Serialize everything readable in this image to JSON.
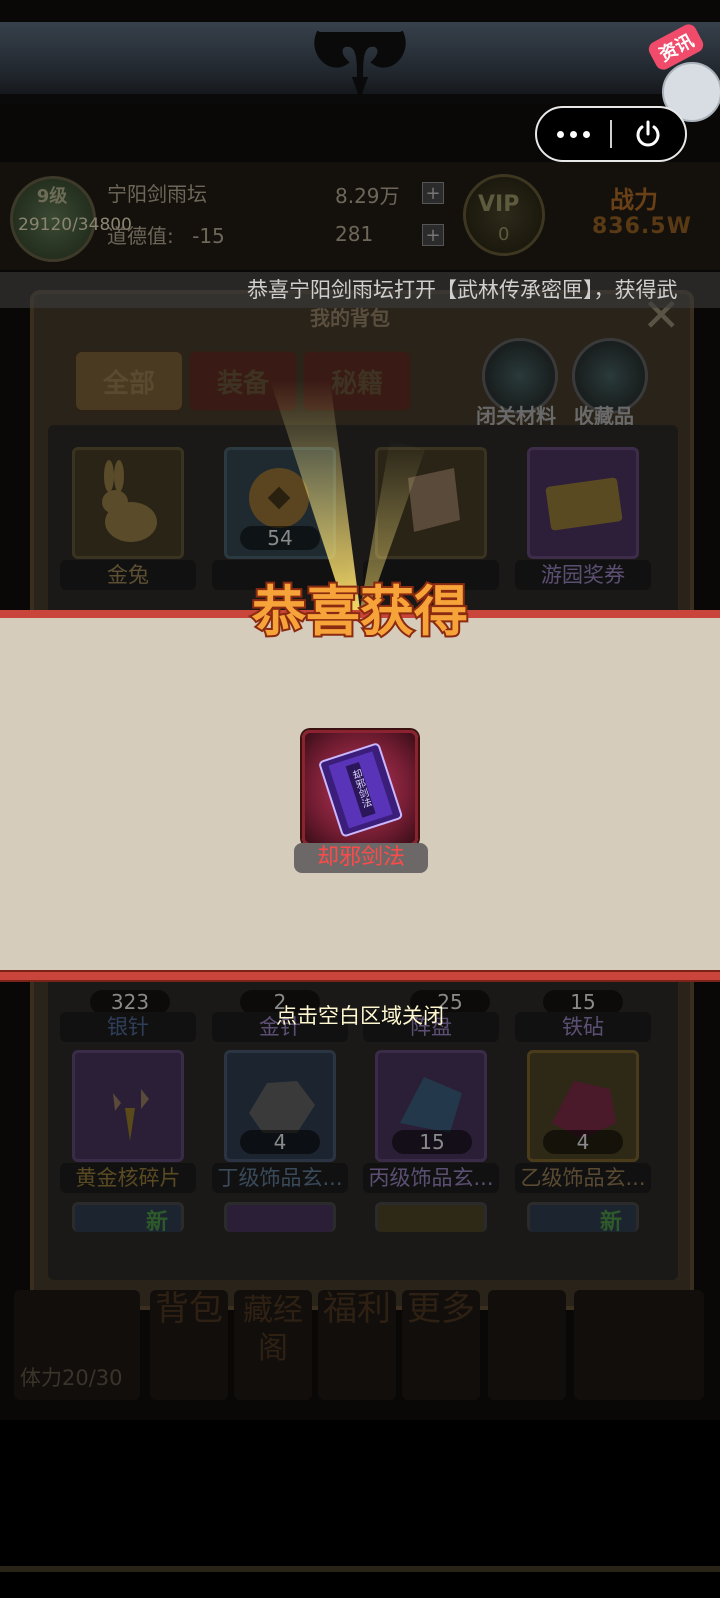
{
  "news_badge": {
    "label": "资讯"
  },
  "hud": {
    "level": "9级",
    "hp": "29120/34800",
    "player_name": "宁阳剑雨坛",
    "morality_label": "道德值:",
    "morality_value": "-15",
    "silver": "8.29万",
    "gold": "281",
    "vip_label": "VIP",
    "vip_level": "0",
    "power_label": "战力",
    "power_value": "836.5W"
  },
  "marquee": "恭喜宁阳剑雨坛打开【武林传承密匣】，获得武",
  "bag": {
    "title": "我的背包",
    "tabs": [
      "全部",
      "装备",
      "秘籍"
    ],
    "side_buttons": [
      "闭关材料",
      "收藏品"
    ],
    "items": [
      {
        "name": "金兔",
        "count": ""
      },
      {
        "name": "",
        "count": "54"
      },
      {
        "name": "",
        "count": ""
      },
      {
        "name": "游园奖券",
        "count": ""
      },
      {
        "name": "银针",
        "count": "323"
      },
      {
        "name": "金针",
        "count": "2"
      },
      {
        "name": "阵盘",
        "count": "25"
      },
      {
        "name": "铁砧",
        "count": "15"
      },
      {
        "name": "黄金核碎片",
        "count": ""
      },
      {
        "name": "丁级饰品玄...",
        "count": "4"
      },
      {
        "name": "丙级饰品玄...",
        "count": "15"
      },
      {
        "name": "乙级饰品玄...",
        "count": "4"
      }
    ],
    "new_tag": "新"
  },
  "bottom_nav": [
    {
      "label": "背包"
    },
    {
      "label": "藏经阁"
    },
    {
      "label": "福利"
    },
    {
      "label": "更多"
    }
  ],
  "stamina": "体力20/30",
  "modal": {
    "title": "恭喜获得",
    "reward_name": "却邪剑法",
    "book_text": "却邪剑法",
    "close_hint": "点击空白区域关闭"
  },
  "colors": {
    "accent_red": "#c9443a",
    "reward_text": "#ff4a4a",
    "title_orange": "#f5872a"
  }
}
